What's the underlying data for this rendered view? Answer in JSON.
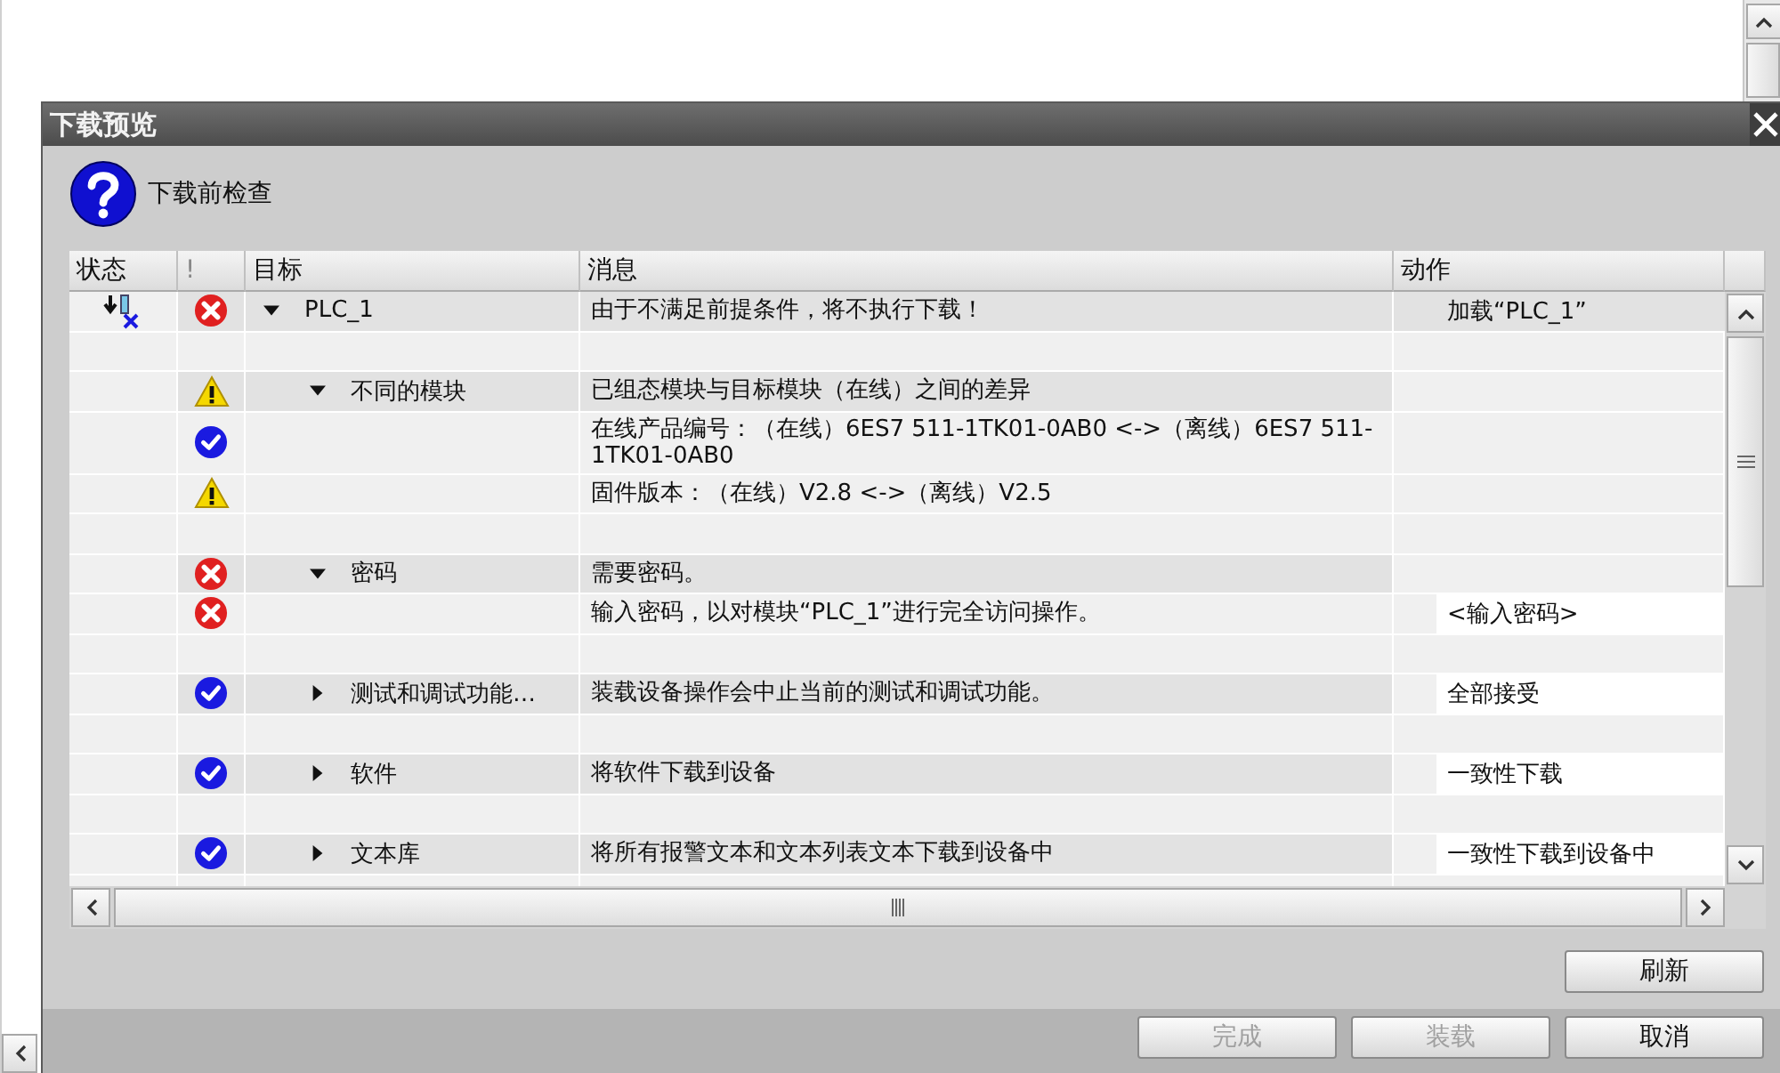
{
  "dialog": {
    "title": "下载预览",
    "heading": "下载前检查",
    "table": {
      "columns": [
        "状态",
        "!",
        "目标",
        "消息",
        "动作"
      ],
      "rows": [
        {
          "download_blocked": true,
          "kind": "error",
          "target": "PLC_1",
          "expanded": true,
          "message": "由于不满足前提条件，将不执行下载！",
          "action": {
            "kind": "text",
            "label": "加载“PLC_1”"
          },
          "children": [
            {
              "kind": "warning",
              "target": "不同的模块",
              "expanded": true,
              "message": "已组态模块与目标模块（在线）之间的差异",
              "children": [
                {
                  "kind": "ok",
                  "message": "在线产品编号：（在线）6ES7 511-1TK01-0AB0 <->（离线）6ES7 511-1TK01-0AB0"
                },
                {
                  "kind": "warning",
                  "message": "固件版本：（在线）V2.8 <->（离线）V2.5"
                }
              ]
            },
            {
              "kind": "error",
              "target": "密码",
              "expanded": true,
              "message": "需要密码。",
              "children": [
                {
                  "kind": "error",
                  "message": "输入密码，以对模块“PLC_1”进行完全访问操作。",
                  "action": {
                    "kind": "field",
                    "label": "<输入密码>"
                  }
                }
              ]
            },
            {
              "kind": "ok",
              "target": "测试和调试功能…",
              "expanded": false,
              "message": "装载设备操作会中止当前的测试和调试功能。",
              "action": {
                "kind": "field",
                "label": "全部接受"
              }
            },
            {
              "kind": "ok",
              "target": "软件",
              "expanded": false,
              "message": "将软件下载到设备",
              "action": {
                "kind": "field",
                "label": "一致性下载"
              }
            },
            {
              "kind": "ok",
              "target": "文本库",
              "expanded": false,
              "message": "将所有报警文本和文本列表文本下载到设备中",
              "action": {
                "kind": "field",
                "label": "一致性下载到设备中"
              }
            }
          ]
        }
      ]
    },
    "refresh": "刷新",
    "buttons": [
      {
        "label": "完成",
        "disabled": true
      },
      {
        "label": "装载",
        "disabled": true
      },
      {
        "label": "取消",
        "disabled": false
      }
    ]
  }
}
